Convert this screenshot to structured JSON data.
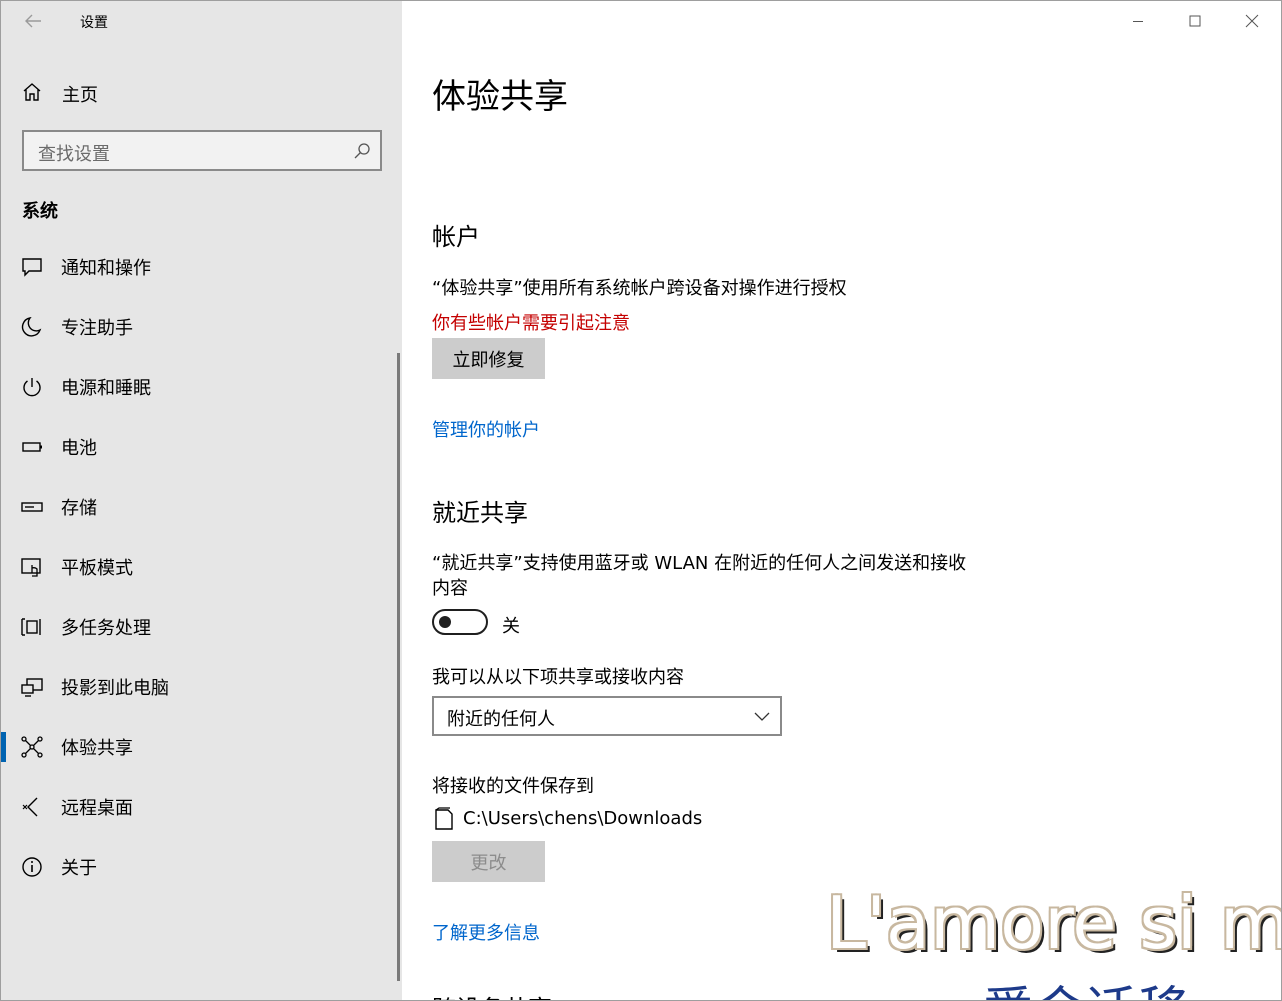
{
  "window": {
    "title": "设置"
  },
  "sidebar": {
    "home_label": "主页",
    "search_placeholder": "查找设置",
    "section_title": "系统",
    "items": [
      {
        "label": "通知和操作",
        "icon": "notification-icon"
      },
      {
        "label": "专注助手",
        "icon": "moon-icon"
      },
      {
        "label": "电源和睡眠",
        "icon": "power-icon"
      },
      {
        "label": "电池",
        "icon": "battery-icon"
      },
      {
        "label": "存储",
        "icon": "storage-icon"
      },
      {
        "label": "平板模式",
        "icon": "tablet-mode-icon"
      },
      {
        "label": "多任务处理",
        "icon": "multitasking-icon"
      },
      {
        "label": "投影到此电脑",
        "icon": "project-icon"
      },
      {
        "label": "体验共享",
        "icon": "shared-experiences-icon",
        "active": true
      },
      {
        "label": "远程桌面",
        "icon": "remote-desktop-icon"
      },
      {
        "label": "关于",
        "icon": "info-icon"
      }
    ]
  },
  "main": {
    "page_title": "体验共享",
    "accounts": {
      "heading": "帐户",
      "description": "“体验共享”使用所有系统帐户跨设备对操作进行授权",
      "warning": "你有些帐户需要引起注意",
      "fix_button": "立即修复",
      "manage_link": "管理你的帐户"
    },
    "nearby": {
      "heading": "就近共享",
      "description_line1": "“就近共享”支持使用蓝牙或 WLAN 在附近的任何人之间发送和接收",
      "description_line2": "内容",
      "toggle_state": "关",
      "share_from_label": "我可以从以下项共享或接收内容",
      "share_from_value": "附近的任何人",
      "save_to_label": "将接收的文件保存到",
      "save_path": "C:\\Users\\chens\\Downloads",
      "change_button": "更改",
      "learn_more_link": "了解更多信息"
    },
    "cut_heading": "跨设备共享"
  },
  "overlay": {
    "watermark_line1": "L'amore si mu",
    "watermark_line2": "爱会迁移"
  },
  "colors": {
    "accent": "#0063b1",
    "link": "#0066cc",
    "warning": "#c40000"
  }
}
